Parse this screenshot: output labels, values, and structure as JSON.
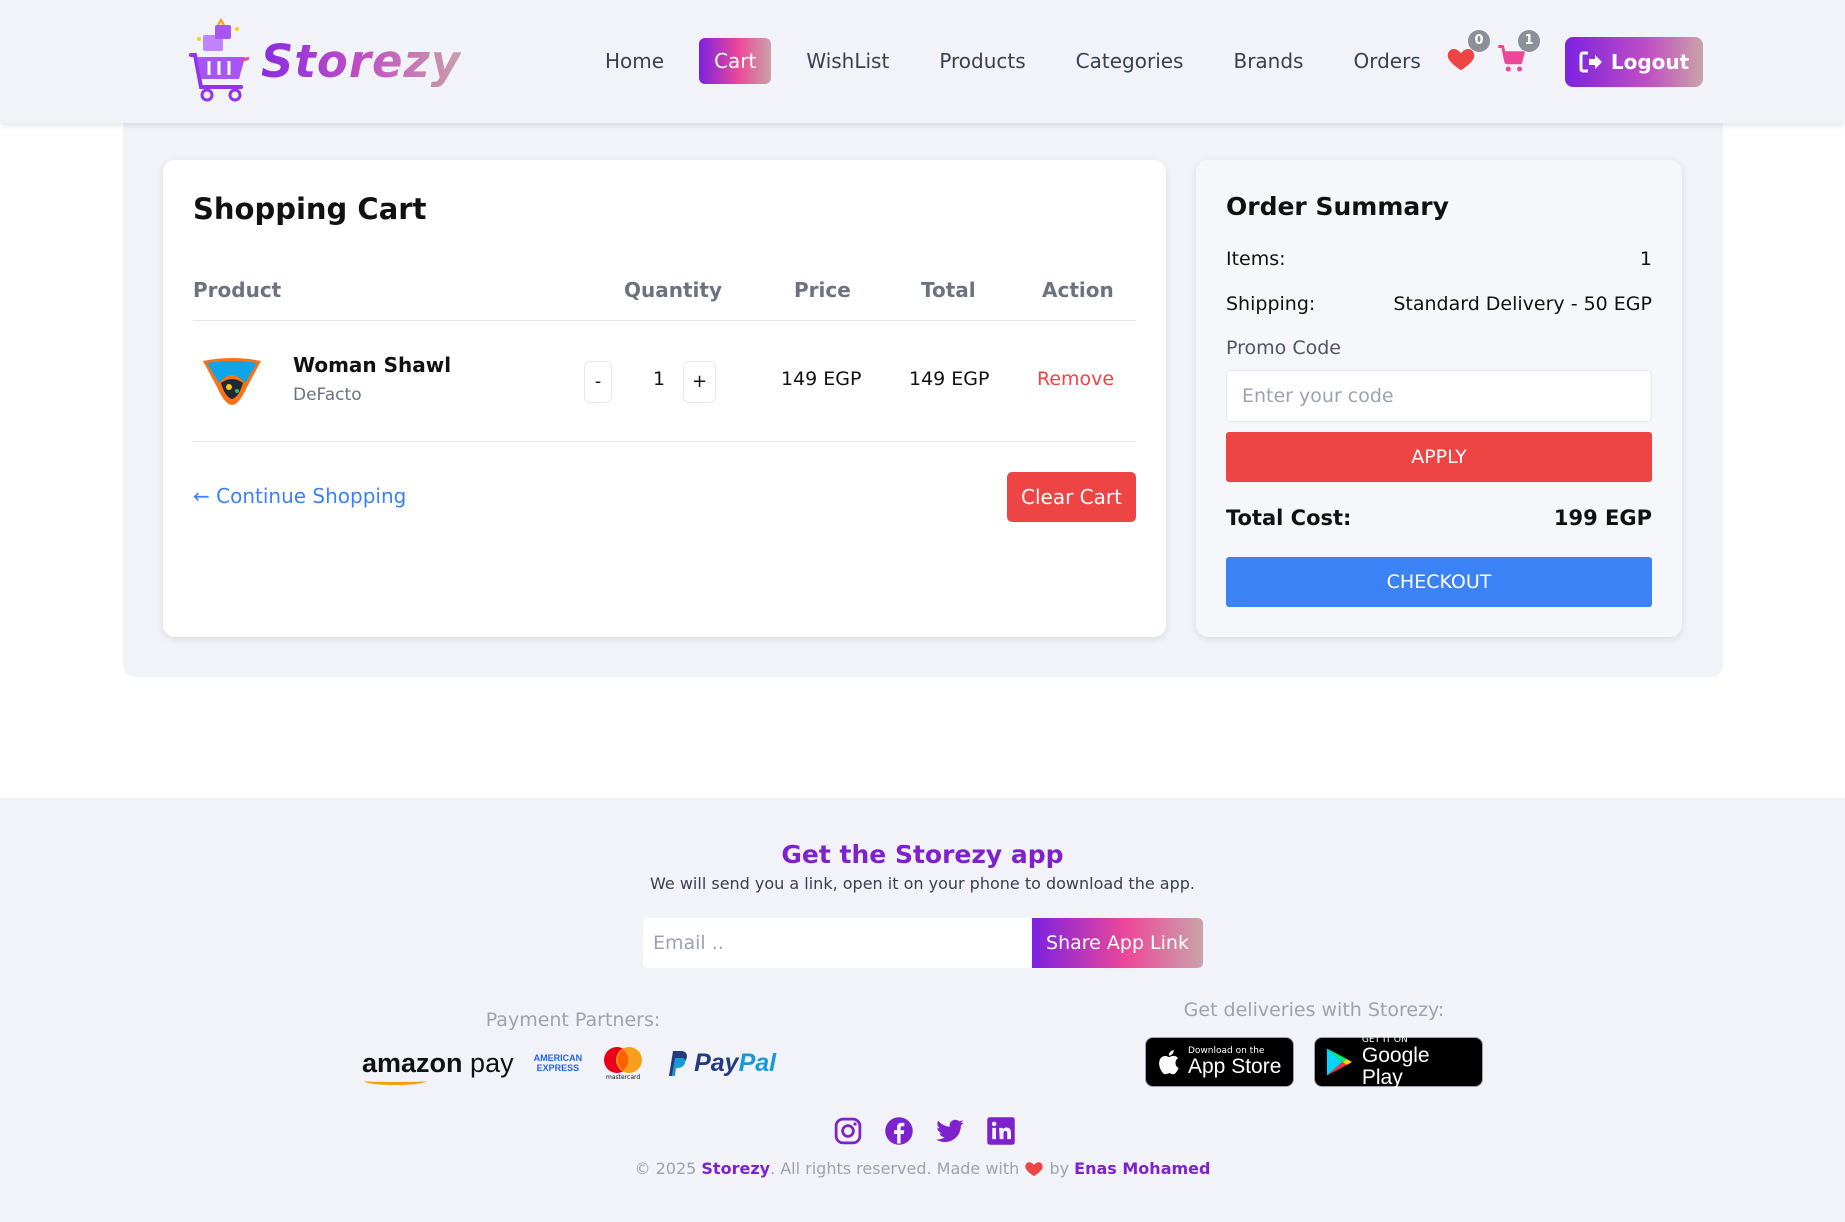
{
  "nav": {
    "brand": "Storezy",
    "links": [
      "Home",
      "Cart",
      "WishList",
      "Products",
      "Categories",
      "Brands",
      "Orders"
    ],
    "active": "Cart",
    "wishlist_count": "0",
    "cart_count": "1",
    "logout_label": "Logout"
  },
  "cart": {
    "title": "Shopping Cart",
    "headers": {
      "product": "Product",
      "quantity": "Quantity",
      "price": "Price",
      "total": "Total",
      "action": "Action"
    },
    "items": [
      {
        "name": "Woman Shawl",
        "brand": "DeFacto",
        "quantity": "1",
        "price": "149 EGP",
        "total": "149 EGP",
        "action": "Remove"
      }
    ],
    "minus": "-",
    "plus": "+",
    "continue": "← Continue Shopping",
    "clear": "Clear Cart"
  },
  "summary": {
    "title": "Order Summary",
    "items_label": "Items:",
    "items_value": "1",
    "shipping_label": "Shipping:",
    "shipping_value": "Standard Delivery - 50 EGP",
    "promo_label": "Promo Code",
    "promo_placeholder": "Enter your code",
    "apply": "APPLY",
    "total_label": "Total Cost:",
    "total_value": "199 EGP",
    "checkout": "CHECKOUT"
  },
  "footer": {
    "app_title": "Get the Storezy app",
    "app_sub": "We will send you a link, open it on your phone to download the app.",
    "email_placeholder": "Email ..",
    "share": "Share App Link",
    "payment_title": "Payment Partners:",
    "delivery_title": "Get deliveries with Storezy:",
    "payment_partners": {
      "amazon_a": "amazon",
      "amazon_b": "pay",
      "amex_a": "AMERICAN",
      "amex_b": "EXPRESS",
      "mastercard": "mastercard",
      "paypal_a": "Pay",
      "paypal_b": "Pal"
    },
    "app_store_small": "Download on the",
    "app_store_big": "App Store",
    "google_small": "GET IT ON",
    "google_big": "Google Play",
    "copy_prefix": "© 2025 ",
    "copy_brand": "Storezy",
    "copy_mid": ". All rights reserved. Made with ",
    "copy_by": " by ",
    "copy_author": "Enas Mohamed"
  },
  "colors": {
    "brand_purple": "#7e22ce",
    "pink": "#ec4899",
    "red": "#ef4444",
    "blue": "#3b82f6"
  }
}
